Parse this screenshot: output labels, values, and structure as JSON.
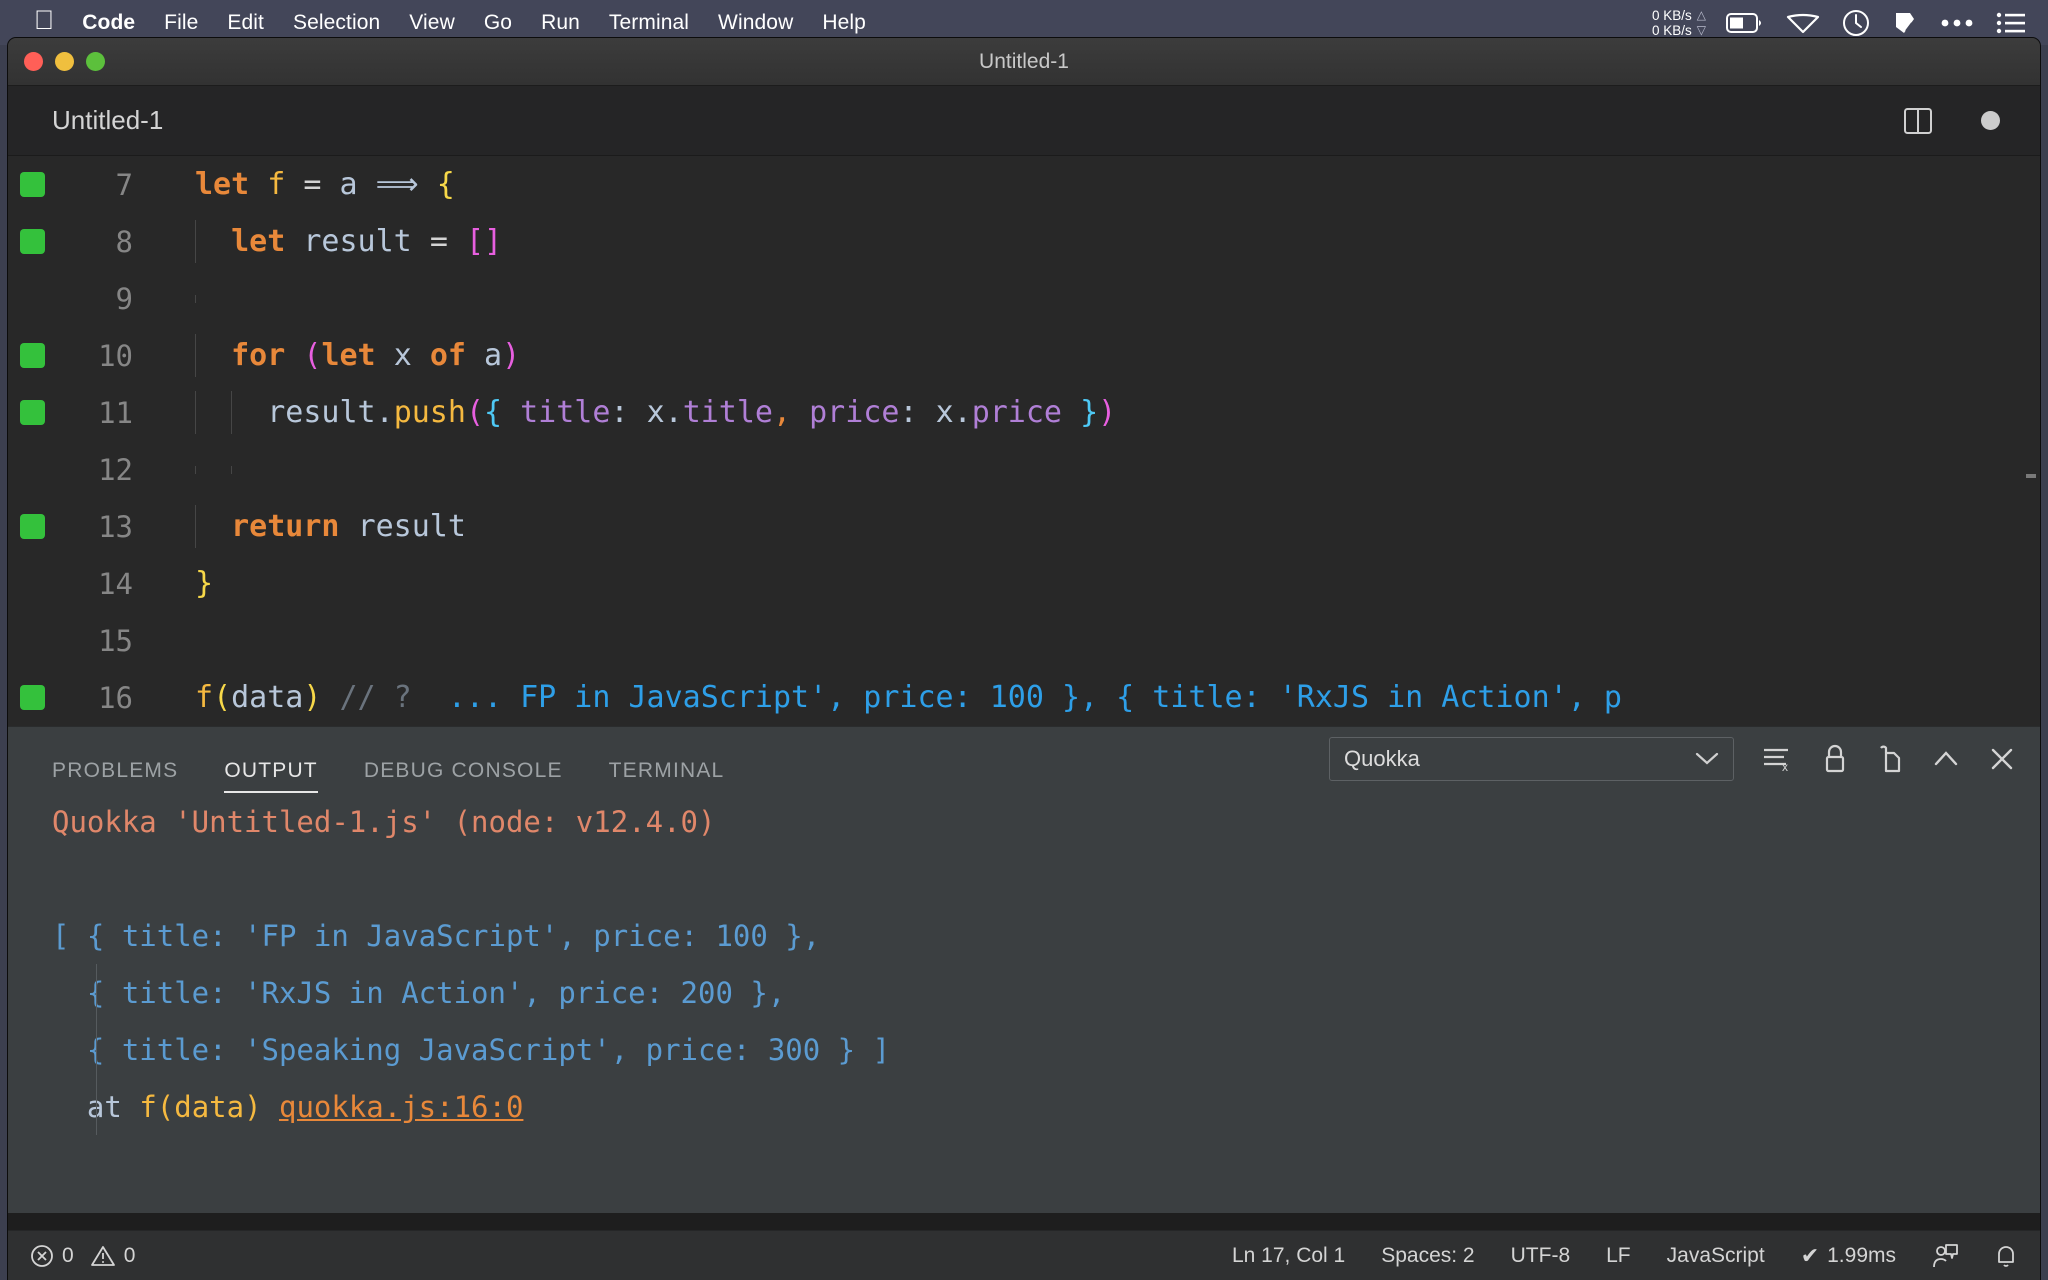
{
  "menubar": {
    "apple_icon": "apple-icon",
    "items": [
      {
        "label": "Code",
        "bold": true
      },
      {
        "label": "File",
        "bold": false
      },
      {
        "label": "Edit",
        "bold": false
      },
      {
        "label": "Selection",
        "bold": false
      },
      {
        "label": "View",
        "bold": false
      },
      {
        "label": "Go",
        "bold": false
      },
      {
        "label": "Run",
        "bold": false
      },
      {
        "label": "Terminal",
        "bold": false
      },
      {
        "label": "Window",
        "bold": false
      },
      {
        "label": "Help",
        "bold": false
      }
    ],
    "network": {
      "up": "0 KB/s",
      "down": "0 KB/s"
    },
    "tray": [
      "battery-icon",
      "wifi-icon",
      "clock-icon",
      "dropbox-icon",
      "ellipsis-icon",
      "control-center-icon"
    ]
  },
  "window": {
    "title": "Untitled-1",
    "traffic_lights": [
      "close-button",
      "minimize-button",
      "maximize-button"
    ]
  },
  "editor": {
    "tab_label": "Untitled-1",
    "split_icon": "split-editor-icon",
    "dirty_indicator": "unsaved-dot-icon",
    "lines": [
      {
        "num": "7",
        "has_run_marker": true,
        "indent_guides": 0,
        "tokens": [
          {
            "t": "let",
            "c": "kw"
          },
          {
            "t": " ",
            "c": "op"
          },
          {
            "t": "f",
            "c": "fn"
          },
          {
            "t": " ",
            "c": "op"
          },
          {
            "t": "=",
            "c": "op"
          },
          {
            "t": " ",
            "c": "op"
          },
          {
            "t": "a",
            "c": "var"
          },
          {
            "t": " ",
            "c": "op"
          },
          {
            "t": "⟹",
            "c": "var"
          },
          {
            "t": " ",
            "c": "op"
          },
          {
            "t": "{",
            "c": "brkt-y"
          }
        ]
      },
      {
        "num": "8",
        "has_run_marker": true,
        "indent_guides": 1,
        "tokens": [
          {
            "t": "  ",
            "c": "op"
          },
          {
            "t": "let",
            "c": "kw"
          },
          {
            "t": " ",
            "c": "op"
          },
          {
            "t": "result",
            "c": "var"
          },
          {
            "t": " ",
            "c": "op"
          },
          {
            "t": "=",
            "c": "op"
          },
          {
            "t": " ",
            "c": "op"
          },
          {
            "t": "[]",
            "c": "brkt-m"
          }
        ]
      },
      {
        "num": "9",
        "has_run_marker": false,
        "indent_guides": 1,
        "tokens": []
      },
      {
        "num": "10",
        "has_run_marker": true,
        "indent_guides": 1,
        "tokens": [
          {
            "t": "  ",
            "c": "op"
          },
          {
            "t": "for",
            "c": "kw"
          },
          {
            "t": " ",
            "c": "op"
          },
          {
            "t": "(",
            "c": "brkt-m"
          },
          {
            "t": "let",
            "c": "kw"
          },
          {
            "t": " ",
            "c": "op"
          },
          {
            "t": "x",
            "c": "var"
          },
          {
            "t": " ",
            "c": "op"
          },
          {
            "t": "of",
            "c": "kw"
          },
          {
            "t": " ",
            "c": "op"
          },
          {
            "t": "a",
            "c": "var"
          },
          {
            "t": ")",
            "c": "brkt-m"
          }
        ]
      },
      {
        "num": "11",
        "has_run_marker": true,
        "indent_guides": 2,
        "tokens": [
          {
            "t": "    ",
            "c": "op"
          },
          {
            "t": "result",
            "c": "var"
          },
          {
            "t": ".",
            "c": "var"
          },
          {
            "t": "push",
            "c": "fn"
          },
          {
            "t": "(",
            "c": "brkt-m"
          },
          {
            "t": "{",
            "c": "brkt-c"
          },
          {
            "t": " ",
            "c": "op"
          },
          {
            "t": "title",
            "c": "prop"
          },
          {
            "t": ":",
            "c": "var"
          },
          {
            "t": " ",
            "c": "op"
          },
          {
            "t": "x",
            "c": "var"
          },
          {
            "t": ".",
            "c": "var"
          },
          {
            "t": "title",
            "c": "prop"
          },
          {
            "t": ",",
            "c": "op-or"
          },
          {
            "t": " ",
            "c": "op"
          },
          {
            "t": "price",
            "c": "prop"
          },
          {
            "t": ":",
            "c": "var"
          },
          {
            "t": " ",
            "c": "op"
          },
          {
            "t": "x",
            "c": "var"
          },
          {
            "t": ".",
            "c": "var"
          },
          {
            "t": "price",
            "c": "prop"
          },
          {
            "t": " ",
            "c": "op"
          },
          {
            "t": "}",
            "c": "brkt-c"
          },
          {
            "t": ")",
            "c": "brkt-m"
          }
        ]
      },
      {
        "num": "12",
        "has_run_marker": false,
        "indent_guides": 2,
        "tokens": []
      },
      {
        "num": "13",
        "has_run_marker": true,
        "indent_guides": 1,
        "tokens": [
          {
            "t": "  ",
            "c": "op"
          },
          {
            "t": "return",
            "c": "kw"
          },
          {
            "t": " ",
            "c": "op"
          },
          {
            "t": "result",
            "c": "var"
          }
        ]
      },
      {
        "num": "14",
        "has_run_marker": false,
        "indent_guides": 0,
        "tokens": [
          {
            "t": "}",
            "c": "brkt-y"
          }
        ]
      },
      {
        "num": "15",
        "has_run_marker": false,
        "indent_guides": 0,
        "tokens": []
      },
      {
        "num": "16",
        "has_run_marker": true,
        "indent_guides": 0,
        "tokens": [
          {
            "t": "f",
            "c": "fn"
          },
          {
            "t": "(",
            "c": "brkt-y"
          },
          {
            "t": "data",
            "c": "var"
          },
          {
            "t": ")",
            "c": "brkt-y"
          },
          {
            "t": " ",
            "c": "op"
          },
          {
            "t": "// ?",
            "c": "cmt"
          },
          {
            "t": "  ",
            "c": "op"
          },
          {
            "t": "... FP in JavaScript', price: 100 }, { title: 'RxJS in Action', p",
            "c": "quokka"
          }
        ]
      }
    ]
  },
  "panel": {
    "tabs": [
      {
        "label": "PROBLEMS",
        "active": false
      },
      {
        "label": "OUTPUT",
        "active": true
      },
      {
        "label": "DEBUG CONSOLE",
        "active": false
      },
      {
        "label": "TERMINAL",
        "active": false
      }
    ],
    "channel": {
      "value": "Quokka",
      "chevron": "chevron-down-icon"
    },
    "actions": [
      {
        "name": "clear-output-icon"
      },
      {
        "name": "lock-scroll-icon"
      },
      {
        "name": "open-in-editor-icon"
      },
      {
        "name": "maximize-panel-icon"
      },
      {
        "name": "close-panel-icon"
      }
    ],
    "output_lines": [
      {
        "indent_guide": false,
        "spans": [
          {
            "t": "Quokka 'Untitled-1.js' (node: v12.4.0)",
            "c": "o-head"
          }
        ]
      },
      {
        "indent_guide": false,
        "spans": []
      },
      {
        "indent_guide": false,
        "spans": [
          {
            "t": "[ { title: 'FP in JavaScript', price: 100 },",
            "c": "o-val"
          }
        ]
      },
      {
        "indent_guide": true,
        "spans": [
          {
            "t": "  { title: 'RxJS in Action', price: 200 },",
            "c": "o-val"
          }
        ]
      },
      {
        "indent_guide": true,
        "spans": [
          {
            "t": "  { title: 'Speaking JavaScript', price: 300 } ]",
            "c": "o-val"
          }
        ]
      },
      {
        "indent_guide": true,
        "spans": [
          {
            "t": "  at ",
            "c": "o-at"
          },
          {
            "t": "f(data)",
            "c": "o-fn"
          },
          {
            "t": " ",
            "c": "o-at"
          },
          {
            "t": "quokka.js:16:0",
            "c": "o-link"
          }
        ]
      }
    ]
  },
  "statusbar": {
    "errors": "0",
    "warnings": "0",
    "error_icon": "error-circle-icon",
    "warning_icon": "warning-triangle-icon",
    "cursor_position": "Ln 17, Col 1",
    "indentation": "Spaces: 2",
    "encoding": "UTF-8",
    "eol": "LF",
    "language": "JavaScript",
    "quokka_time": "1.99ms",
    "quokka_check": "✔",
    "feedback_icon": "feedback-icon",
    "bell_icon": "bell-icon"
  },
  "colors": {
    "menubar_bg": "#434659",
    "editor_bg": "#282828",
    "panel_bg": "#3b3f41",
    "status_bg": "#2f3031",
    "run_marker": "#34c13c",
    "quokka_value": "#2e9fe8",
    "output_value": "#5b9bd1",
    "output_head": "#e0876a",
    "link": "#e8883a"
  }
}
